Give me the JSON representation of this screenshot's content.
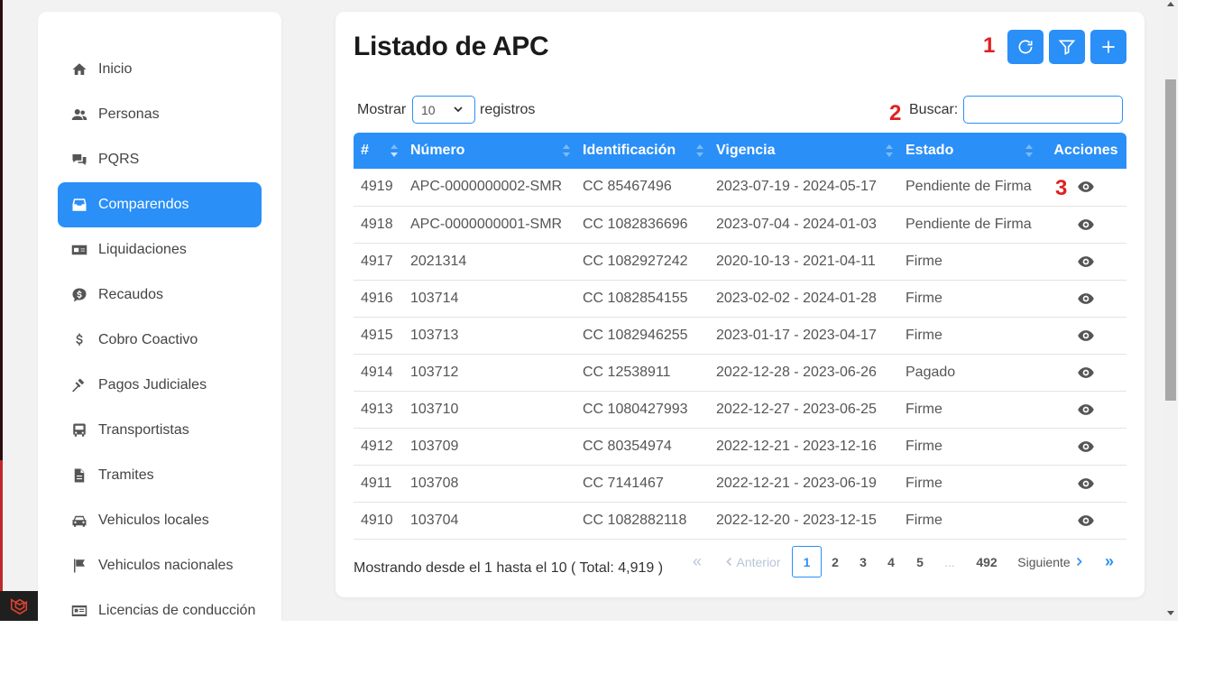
{
  "sidebar": {
    "items": [
      {
        "label": "Inicio",
        "icon": "home-icon"
      },
      {
        "label": "Personas",
        "icon": "users-icon"
      },
      {
        "label": "PQRS",
        "icon": "comments-icon"
      },
      {
        "label": "Comparendos",
        "icon": "inbox-icon",
        "active": true
      },
      {
        "label": "Liquidaciones",
        "icon": "money-bill-icon"
      },
      {
        "label": "Recaudos",
        "icon": "comment-dollar-icon"
      },
      {
        "label": "Cobro Coactivo",
        "icon": "dollar-icon"
      },
      {
        "label": "Pagos Judiciales",
        "icon": "gavel-icon"
      },
      {
        "label": "Transportistas",
        "icon": "bus-icon"
      },
      {
        "label": "Tramites",
        "icon": "file-icon"
      },
      {
        "label": "Vehiculos locales",
        "icon": "car-icon"
      },
      {
        "label": "Vehiculos nacionales",
        "icon": "flag-icon"
      },
      {
        "label": "Licencias de conducción",
        "icon": "id-card-icon"
      }
    ]
  },
  "main": {
    "title": "Listado de APC",
    "markers": {
      "one": "1",
      "two": "2",
      "three": "3"
    },
    "toolbar": {
      "refresh_icon": "refresh-icon",
      "filter_icon": "filter-icon",
      "add_icon": "plus-icon"
    },
    "length": {
      "prefix": "Mostrar",
      "value": "10",
      "suffix": "registros"
    },
    "search": {
      "label": "Buscar:",
      "value": "",
      "placeholder": ""
    },
    "table": {
      "columns": [
        "#",
        "Número",
        "Identificación",
        "Vigencia",
        "Estado",
        "Acciones"
      ],
      "rows": [
        [
          "4919",
          "APC-0000000002-SMR",
          "CC 85467496",
          "2023-07-19 - 2024-05-17",
          "Pendiente de Firma"
        ],
        [
          "4918",
          "APC-0000000001-SMR",
          "CC 1082836696",
          "2023-07-04 - 2024-01-03",
          "Pendiente de Firma"
        ],
        [
          "4917",
          "2021314",
          "CC 1082927242",
          "2020-10-13 - 2021-04-11",
          "Firme"
        ],
        [
          "4916",
          "103714",
          "CC 1082854155",
          "2023-02-02 - 2024-01-28",
          "Firme"
        ],
        [
          "4915",
          "103713",
          "CC 1082946255",
          "2023-01-17 - 2023-04-17",
          "Firme"
        ],
        [
          "4914",
          "103712",
          "CC 12538911",
          "2022-12-28 - 2023-06-26",
          "Pagado"
        ],
        [
          "4913",
          "103710",
          "CC 1080427993",
          "2022-12-27 - 2023-06-25",
          "Firme"
        ],
        [
          "4912",
          "103709",
          "CC 80354974",
          "2022-12-21 - 2023-12-16",
          "Firme"
        ],
        [
          "4911",
          "103708",
          "CC 7141467",
          "2022-12-21 - 2023-06-19",
          "Firme"
        ],
        [
          "4910",
          "103704",
          "CC 1082882118",
          "2022-12-20 - 2023-12-15",
          "Firme"
        ]
      ]
    },
    "footer": {
      "info": "Mostrando desde el 1 hasta el 10 ( Total: 4,919 )",
      "first": "«",
      "prev": "Anterior",
      "pages": [
        "1",
        "2",
        "3",
        "4",
        "5"
      ],
      "ellipsis": "...",
      "last_page": "492",
      "next": "Siguiente",
      "last": "»"
    }
  },
  "colors": {
    "accent": "#2a8ff7",
    "marker": "#e02020"
  }
}
